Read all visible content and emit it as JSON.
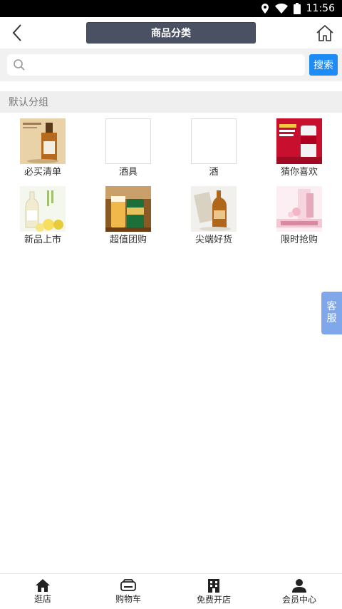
{
  "status": {
    "time": "11:56"
  },
  "header": {
    "title": "商品分类"
  },
  "search": {
    "placeholder": "",
    "button_label": "搜索"
  },
  "group": {
    "title": "默认分组"
  },
  "categories": [
    {
      "label": "必买清单",
      "icon": "whisky-bottle-image"
    },
    {
      "label": "酒具",
      "icon": "empty-image"
    },
    {
      "label": "酒",
      "icon": "empty-image"
    },
    {
      "label": "猜你喜欢",
      "icon": "beer-can-promo-image"
    },
    {
      "label": "新品上市",
      "icon": "sake-bottle-image"
    },
    {
      "label": "超值团购",
      "icon": "beer-glass-image"
    },
    {
      "label": "尖端好货",
      "icon": "whisky-box-image"
    },
    {
      "label": "限时抢购",
      "icon": "again-gift-image"
    }
  ],
  "kefu": {
    "line1": "客",
    "line2": "服"
  },
  "tabbar": [
    {
      "label": "逛店",
      "icon": "home-icon"
    },
    {
      "label": "购物车",
      "icon": "cart-icon"
    },
    {
      "label": "免费开店",
      "icon": "building-icon"
    },
    {
      "label": "会员中心",
      "icon": "user-icon"
    }
  ]
}
